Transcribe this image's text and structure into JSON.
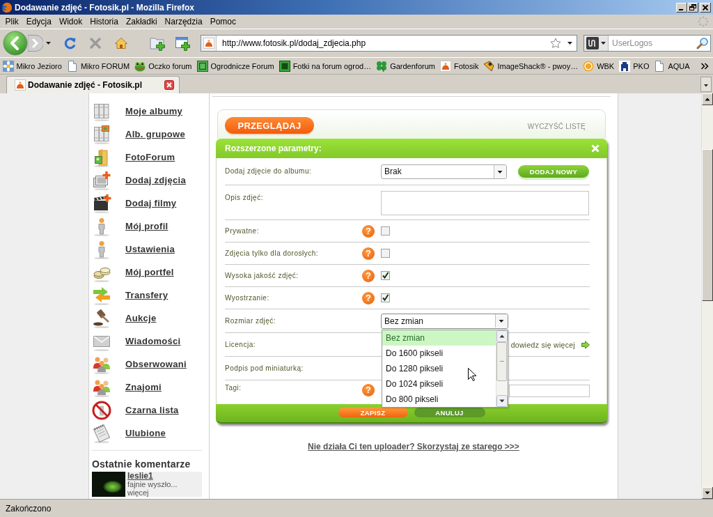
{
  "window": {
    "title": "Dodawanie zdjęć - Fotosik.pl - Mozilla Firefox"
  },
  "menu_bar": {
    "items": [
      "Plik",
      "Edycja",
      "Widok",
      "Historia",
      "Zakładki",
      "Narzędzia",
      "Pomoc"
    ]
  },
  "navigation": {
    "url": "http://www.fotosik.pl/dodaj_zdjecia.php",
    "search": {
      "placeholder": "UserLogos"
    }
  },
  "bookmarks": {
    "items": [
      "Mikro Jezioro",
      "Mikro FORUM",
      "Oczko forum",
      "Ogrodnicze Forum",
      "Fotki na forum ogrod…",
      "Gardenforum",
      "Fotosik",
      "ImageShack® - pwoy…",
      "WBK",
      "PKO",
      "AQUA"
    ]
  },
  "tabs": [
    {
      "label": "Dodawanie zdjęć - Fotosik.pl",
      "selected": true
    }
  ],
  "sidebar": {
    "items": [
      "Moje albumy",
      "Alb. grupowe",
      "FotoForum",
      "Dodaj zdjęcia",
      "Dodaj filmy",
      "Mój profil",
      "Ustawienia",
      "Mój portfel",
      "Transfery",
      "Aukcje",
      "Wiadomości",
      "Obserwowani",
      "Znajomi",
      "Czarna lista",
      "Ulubione"
    ],
    "recent_comments": {
      "title": "Ostatnie komentarze",
      "items": [
        {
          "author": "leslie1",
          "text": "fajnie wyszło...",
          "more": "więcej"
        }
      ]
    }
  },
  "uploader": {
    "browse_button": "PRZEGLĄDAJ",
    "clear_link": "WYCZYŚĆ LISTĘ"
  },
  "parameters": {
    "title": "Rozszerzone parametry:",
    "rows": [
      {
        "kind": "select",
        "label": "Dodaj zdjęcie do albumu:",
        "value": "Brak",
        "expanded": false,
        "button": "DODAJ NOWY"
      },
      {
        "kind": "textarea",
        "label": "Opis zdjęć:"
      },
      {
        "kind": "checkbox",
        "label": "Prywatne:",
        "help": "?",
        "checked": false
      },
      {
        "kind": "checkbox",
        "label": "Zdjęcia tylko dla dorosłych:",
        "help": "?",
        "checked": false
      },
      {
        "kind": "checkbox",
        "label": "Wysoka jakość zdjęć:",
        "help": "?",
        "checked": true
      },
      {
        "kind": "checkbox",
        "label": "Wyostrzanie:",
        "help": "?",
        "checked": true
      },
      {
        "kind": "select",
        "label": "Rozmiar zdjęć:",
        "value": "Bez zmian",
        "expanded": true,
        "options": [
          {
            "label": "Bez zmian",
            "selected": true
          },
          {
            "label": "Do 1600 pikseli",
            "selected": false
          },
          {
            "label": "Do 1280 pikseli",
            "selected": false
          },
          {
            "label": "Do 1024 pikseli",
            "selected": false
          },
          {
            "label": "Do 800 pikseli",
            "selected": false
          }
        ]
      },
      {
        "kind": "link",
        "label": "Licencja:",
        "link": "dowiedz się więcej"
      },
      {
        "kind": "covered",
        "label": "Podpis pod miniaturką:"
      },
      {
        "kind": "input",
        "label": "Tagi:",
        "help": "?"
      }
    ],
    "buttons": [
      {
        "label": "ZAPISZ",
        "kind": "primary"
      },
      {
        "label": "ANULUJ",
        "kind": "secondary"
      }
    ]
  },
  "old_uploader_link": "Nie działa Ci ten uploader? Skorzystaj ze starego >>>",
  "status_bar": {
    "text": "Zakończono"
  }
}
